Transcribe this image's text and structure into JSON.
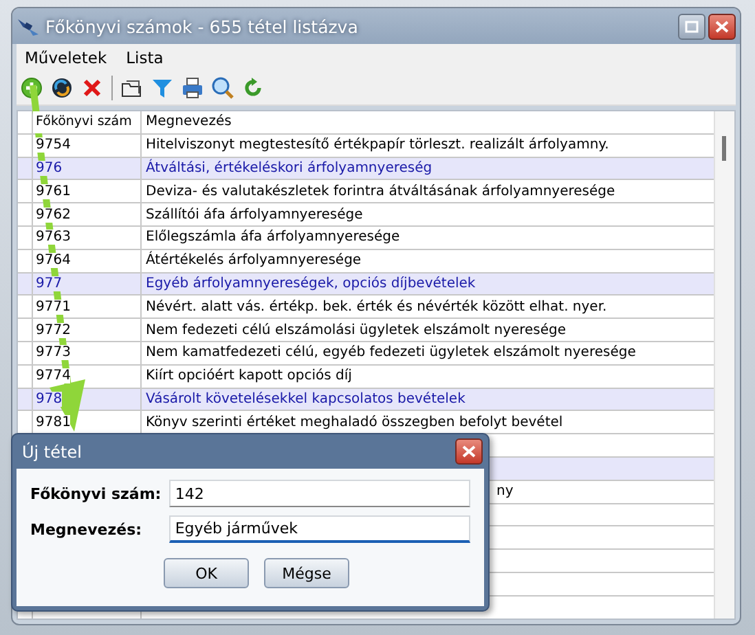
{
  "window": {
    "title": "Főkönyvi számok - 655 tétel listázva"
  },
  "menu": [
    "Műveletek",
    "Lista"
  ],
  "table": {
    "columns": [
      "Főkönyvi szám",
      "Megnevezés"
    ],
    "rows": [
      {
        "kind": "item",
        "code": "9754",
        "name": "Hitelviszonyt megtestesítő értékpapír törleszt. realizált árfolyamny."
      },
      {
        "kind": "group",
        "code": "976",
        "name": "Átváltási, értékeléskori árfolyamnyereség"
      },
      {
        "kind": "item",
        "code": "9761",
        "name": "Deviza- és valutakészletek forintra átváltásának árfolyamnyeresége"
      },
      {
        "kind": "item",
        "code": "9762",
        "name": "Szállítói áfa árfolyamnyeresége"
      },
      {
        "kind": "item",
        "code": "9763",
        "name": "Előlegszámla áfa árfolyamnyeresége"
      },
      {
        "kind": "item",
        "code": "9764",
        "name": "Átértékelés árfolyamnyeresége"
      },
      {
        "kind": "group",
        "code": "977",
        "name": "Egyéb árfolyamnyereségek, opciós díjbevételek"
      },
      {
        "kind": "item",
        "code": "9771",
        "name": "Névért. alatt vás. értékp. bek. érték és névérték között elhat. nyer."
      },
      {
        "kind": "item",
        "code": "9772",
        "name": "Nem fedezeti célú elszámolási ügyletek elszámolt nyeresége"
      },
      {
        "kind": "item",
        "code": "9773",
        "name": "Nem kamatfedezeti célú, egyéb fedezeti ügyletek elszámolt nyeresége"
      },
      {
        "kind": "item",
        "code": "9774",
        "name": "Kiírt opcióért kapott opciós díj"
      },
      {
        "kind": "group",
        "code": "978",
        "name": "Vásárolt követelésekkel kapcsolatos bevételek"
      },
      {
        "kind": "item",
        "code": "9781",
        "name": "Könyv szerinti értéket meghaladó összegben befolyt bevétel"
      },
      {
        "kind": "item"
      },
      {
        "kind": "group"
      },
      {
        "kind": "item",
        "name": "ny",
        "hidden_start": true
      },
      {
        "kind": "item"
      },
      {
        "kind": "item"
      },
      {
        "kind": "item"
      },
      {
        "kind": "item"
      },
      {
        "kind": "item"
      }
    ]
  },
  "dialog": {
    "title": "Új tétel",
    "fields": [
      {
        "label": "Főkönyvi szám:",
        "value": "142",
        "focused": false
      },
      {
        "label": "Megnevezés:",
        "value": "Egyéb járművek",
        "focused": true
      }
    ],
    "buttons": [
      "OK",
      "Mégse"
    ]
  }
}
